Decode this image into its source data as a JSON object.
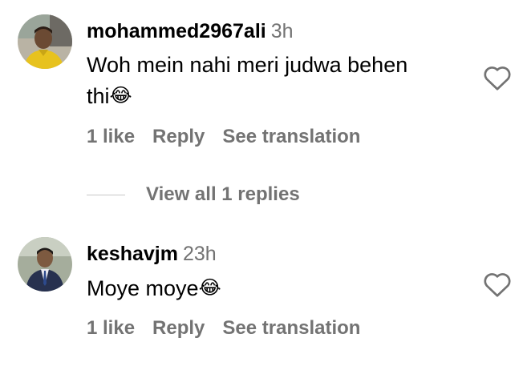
{
  "comments": [
    {
      "username": "mohammed2967ali",
      "time": "3h",
      "text_line1": "Woh mein nahi meri judwa behen",
      "text_line2": "thi",
      "emoji": "😂",
      "likes": "1 like",
      "reply_label": "Reply",
      "translate_label": "See translation"
    },
    {
      "username": "keshavjm",
      "time": "23h",
      "text_line1": "Moye moye",
      "emoji": "😂",
      "likes": "1 like",
      "reply_label": "Reply",
      "translate_label": "See translation"
    }
  ],
  "view_replies": "View all 1 replies",
  "icons": {
    "like": "heart-outline-icon",
    "emoji": "laughing-tears-emoji"
  },
  "colors": {
    "secondary_text": "#737373",
    "divider": "#c7c7c7"
  }
}
